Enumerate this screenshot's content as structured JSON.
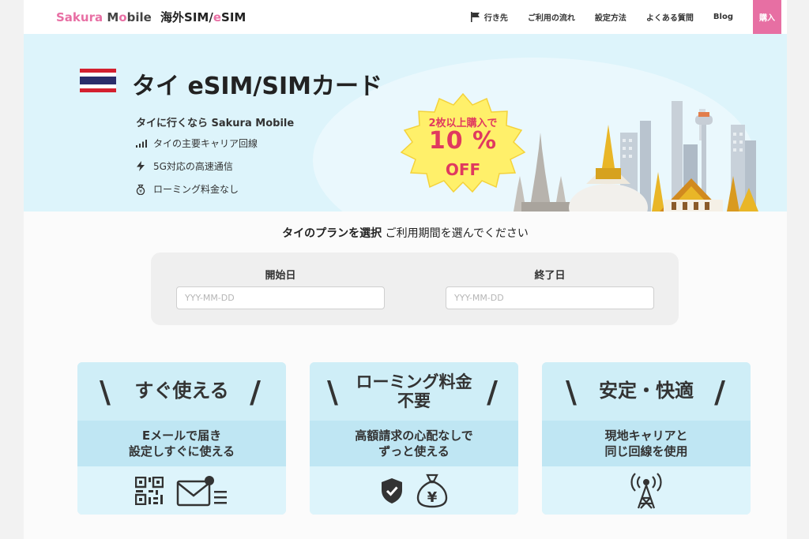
{
  "header": {
    "logo": {
      "part1": "Sakura",
      "part2": "M",
      "part3": "bile",
      "part4": "海外SIM/",
      "part5": "e",
      "part6": "SIM"
    },
    "nav": [
      {
        "label": "行き先",
        "icon": "flag-icon"
      },
      {
        "label": "ご利用の流れ"
      },
      {
        "label": "設定方法"
      },
      {
        "label": "よくある質問"
      },
      {
        "label": "Blog"
      }
    ],
    "buy_label": "購入"
  },
  "hero": {
    "title": "タイ eSIM/SIMカード",
    "subtitle": "タイに行くなら Sakura Mobile",
    "features": [
      {
        "icon": "signal-bars-icon",
        "text": "タイの主要キャリア回線"
      },
      {
        "icon": "lightning-icon",
        "text": "5G対応の高速通信"
      },
      {
        "icon": "coin-bag-icon",
        "text": "ローミング料金なし"
      }
    ],
    "promo": {
      "line1": "2枚以上購入で",
      "line2": "10 %",
      "line3": "OFF"
    }
  },
  "plan": {
    "title_bold": "タイのプランを選択",
    "title_rest": " ご利用期間を選んでください",
    "start_label": "開始日",
    "end_label": "終了日",
    "start_placeholder": "YYY-MM-DD",
    "end_placeholder": "YYY-MM-DD"
  },
  "cards": [
    {
      "title": "すぐ使える",
      "title_line2": "",
      "desc1": "Eメールで届き",
      "desc2": "設定しすぐに使える",
      "icons": [
        "qr-code-icon",
        "email-icon"
      ]
    },
    {
      "title": "ローミング料金",
      "title_line2": "不要",
      "desc1": "高額請求の心配なしで",
      "desc2": "ずっと使える",
      "icons": [
        "shield-check-icon",
        "yen-money-bag-icon"
      ]
    },
    {
      "title": "安定・快適",
      "title_line2": "",
      "desc1": "現地キャリアと",
      "desc2": "同じ回線を使用",
      "icons": [
        "signal-tower-icon"
      ]
    }
  ],
  "colors": {
    "brand_pink": "#e76fa3",
    "hero_bg": "#ddf4fb",
    "card_bg": "#cfeef7",
    "promo_yellow": "#fff06a",
    "promo_red": "#e0395f"
  }
}
